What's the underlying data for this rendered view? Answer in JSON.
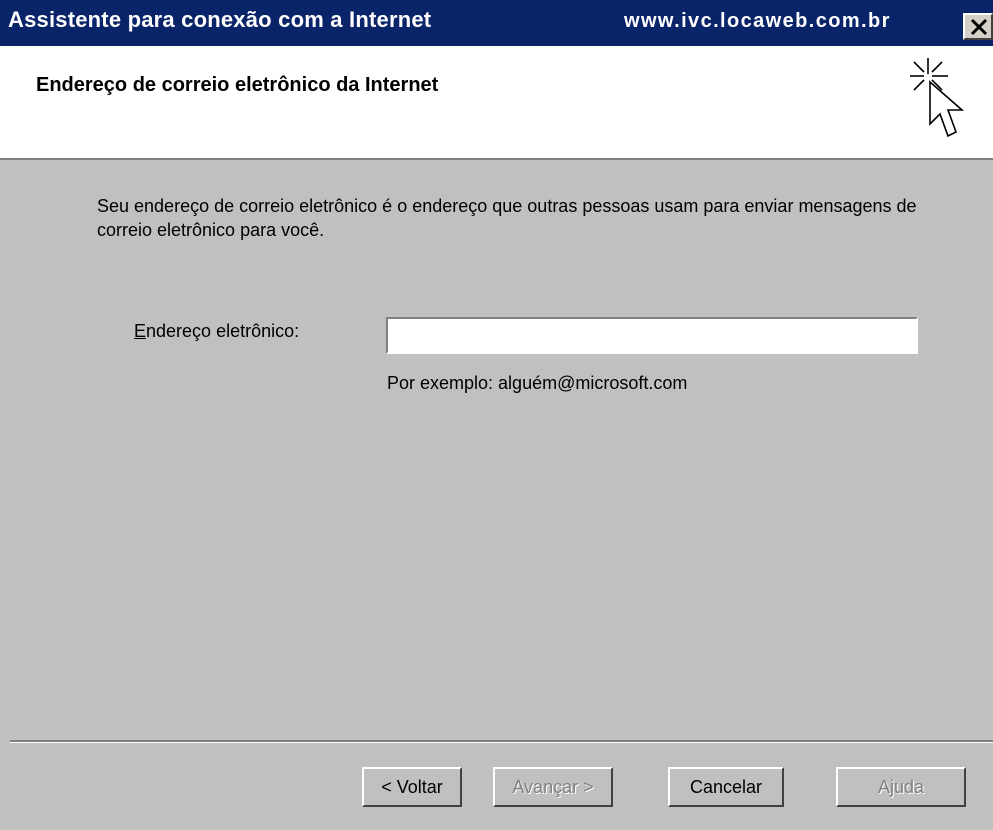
{
  "window": {
    "title": "Assistente para conexão com a Internet",
    "url": "www.ivc.locaweb.com.br"
  },
  "header": {
    "title": "Endereço de correio eletrônico da Internet",
    "icon": "wizard-cursor-icon"
  },
  "content": {
    "description": "Seu endereço de correio eletrônico é o endereço que outras pessoas usam para enviar mensagens de correio eletrônico para você.",
    "email_label_first": "E",
    "email_label_rest": "ndereço eletrônico:",
    "email_value": "",
    "example": "Por exemplo: alguém@microsoft.com"
  },
  "buttons": {
    "back": "< Voltar",
    "next": "Avançar >",
    "cancel": "Cancelar",
    "help": "Ajuda"
  },
  "colors": {
    "titlebar": "#0a246a",
    "dialog": "#c0c0c0",
    "header": "#ffffff"
  }
}
